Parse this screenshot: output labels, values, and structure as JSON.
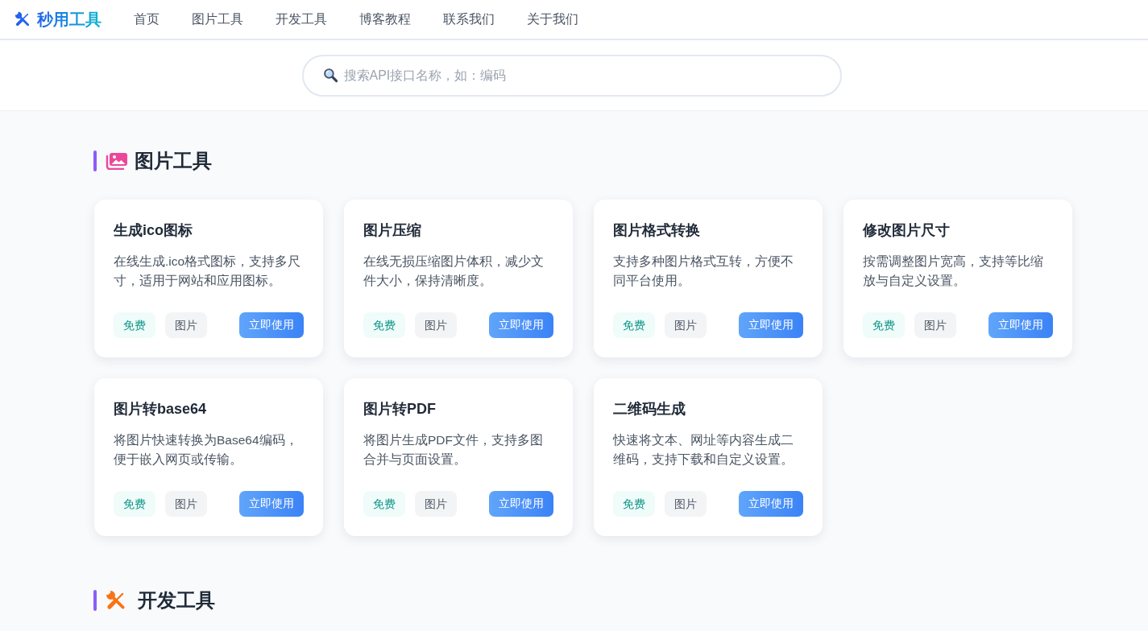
{
  "header": {
    "logo": "秒用工具",
    "nav": [
      {
        "label": "首页"
      },
      {
        "label": "图片工具"
      },
      {
        "label": "开发工具"
      },
      {
        "label": "博客教程"
      },
      {
        "label": "联系我们"
      },
      {
        "label": "关于我们"
      }
    ]
  },
  "search": {
    "placeholder": "搜索API接口名称，如：编码"
  },
  "sections": [
    {
      "kind": "image",
      "title": "图片工具",
      "tools": [
        {
          "title": "生成ico图标",
          "description": "在线生成.ico格式图标，支持多尺寸，适用于网站和应用图标。",
          "tags": [
            {
              "kind": "free",
              "label": "免费"
            },
            {
              "kind": "category",
              "label": "图片"
            }
          ],
          "action": "立即使用"
        },
        {
          "title": "图片压缩",
          "description": "在线无损压缩图片体积，减少文件大小，保持清晰度。",
          "tags": [
            {
              "kind": "free",
              "label": "免费"
            },
            {
              "kind": "category",
              "label": "图片"
            }
          ],
          "action": "立即使用"
        },
        {
          "title": "图片格式转换",
          "description": "支持多种图片格式互转，方便不同平台使用。",
          "tags": [
            {
              "kind": "free",
              "label": "免费"
            },
            {
              "kind": "category",
              "label": "图片"
            }
          ],
          "action": "立即使用"
        },
        {
          "title": "修改图片尺寸",
          "description": "按需调整图片宽高，支持等比缩放与自定义设置。",
          "tags": [
            {
              "kind": "free",
              "label": "免费"
            },
            {
              "kind": "category",
              "label": "图片"
            }
          ],
          "action": "立即使用"
        },
        {
          "title": "图片转base64",
          "description": "将图片快速转换为Base64编码，便于嵌入网页或传输。",
          "tags": [
            {
              "kind": "free",
              "label": "免费"
            },
            {
              "kind": "category",
              "label": "图片"
            }
          ],
          "action": "立即使用"
        },
        {
          "title": "图片转PDF",
          "description": "将图片生成PDF文件，支持多图合并与页面设置。",
          "tags": [
            {
              "kind": "free",
              "label": "免费"
            },
            {
              "kind": "category",
              "label": "图片"
            }
          ],
          "action": "立即使用"
        },
        {
          "title": "二维码生成",
          "description": "快速将文本、网址等内容生成二维码，支持下载和自定义设置。",
          "tags": [
            {
              "kind": "free",
              "label": "免费"
            },
            {
              "kind": "category",
              "label": "图片"
            }
          ],
          "action": "立即使用"
        }
      ]
    },
    {
      "kind": "dev",
      "title": "开发工具"
    }
  ]
}
